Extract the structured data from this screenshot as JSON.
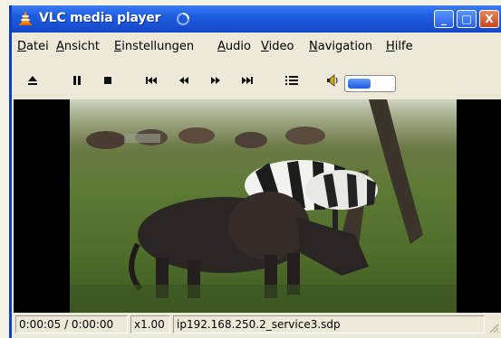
{
  "window": {
    "title": "VLC media player",
    "minimize_label": "_",
    "maximize_label": "□",
    "close_label": "X"
  },
  "menu": {
    "items": [
      {
        "first": "D",
        "rest": "atei"
      },
      {
        "first": "A",
        "rest": "nsicht"
      },
      {
        "first": "E",
        "rest": "instellungen"
      },
      {
        "first": "A",
        "rest": "udio"
      },
      {
        "first": "V",
        "rest": "ideo"
      },
      {
        "first": "N",
        "rest": "avigation"
      },
      {
        "first": "H",
        "rest": "ilfe"
      }
    ]
  },
  "toolbar": {
    "buttons": [
      "eject-icon",
      "pause-icon",
      "stop-icon",
      "skip-back-icon",
      "rewind-icon",
      "fast-forward-icon",
      "skip-forward-icon",
      "playlist-icon",
      "speaker-icon"
    ],
    "volume_level": 0.45,
    "accent": "#1f59d8"
  },
  "video": {
    "scene": "wildebeest and zebras grazing in grass"
  },
  "status": {
    "time": "0:00:05 / 0:00:00",
    "speed": "x1.00",
    "stream": "ip192.168.250.2_service3.sdp"
  },
  "colors": {
    "titlebar": "#1f5fe2",
    "chrome": "#ece9d8"
  }
}
